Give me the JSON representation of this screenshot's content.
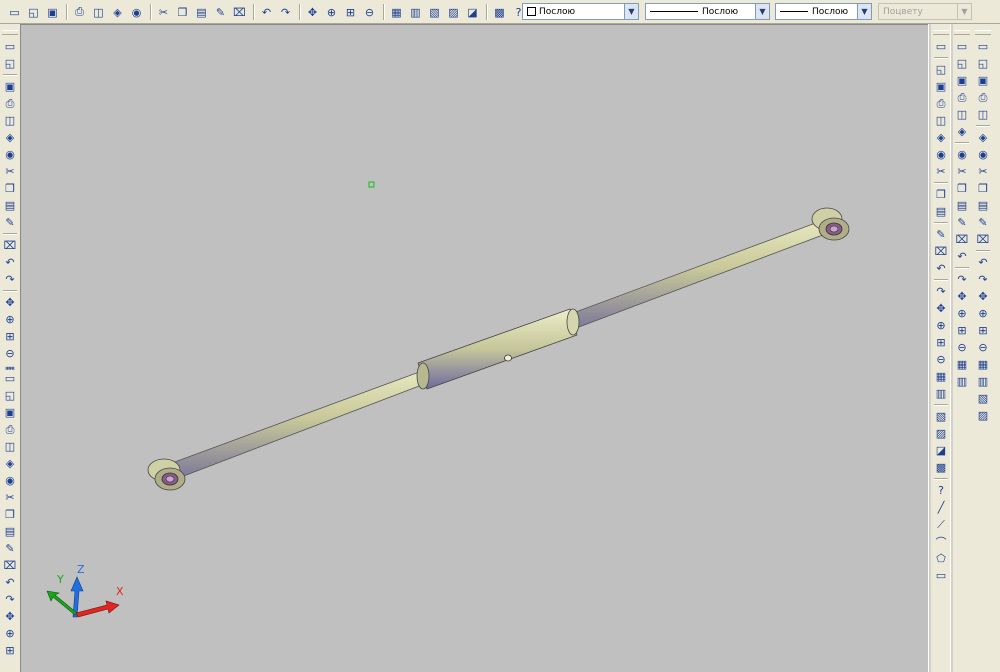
{
  "toolbar": {
    "standard_icons": [
      "new-icon",
      "open-icon",
      "save-icon",
      "print-icon",
      "print-preview-icon",
      "publish-icon",
      "3d-dwf-icon",
      "cut-icon",
      "copy-icon",
      "paste-icon",
      "match-properties-icon",
      "block-editor-icon",
      "undo-icon",
      "redo-icon",
      "pan-icon",
      "zoom-realtime-icon",
      "zoom-window-icon",
      "zoom-previous-icon",
      "properties-icon",
      "design-center-icon",
      "tool-palettes-icon",
      "sheet-set-icon",
      "markup-icon",
      "calculator-icon",
      "help-icon"
    ],
    "color_combo": {
      "value": "Послою",
      "swatch": "#ffffff"
    },
    "linetype_combo": {
      "value": "Послою"
    },
    "lineweight_combo": {
      "value": "Послою"
    },
    "plotstyle_combo": {
      "value": "Поцвету"
    }
  },
  "draw_toolbar": {
    "icons": [
      "line-icon",
      "construction-line-icon",
      "polyline-icon",
      "polygon-icon",
      "rectangle-icon",
      "arc-icon",
      "circle-icon",
      "revision-cloud-icon",
      "spline-icon",
      "ellipse-icon",
      "ellipse-arc-icon",
      "insert-block-icon",
      "make-block-icon",
      "point-icon",
      "hatch-icon",
      "gradient-icon",
      "region-icon",
      "table-icon",
      "multiline-text-icon"
    ]
  },
  "modify_toolbar": {
    "icons": [
      "erase-icon",
      "copy-object-icon",
      "mirror-icon",
      "offset-icon",
      "array-icon",
      "move-icon",
      "rotate-icon",
      "scale-icon",
      "stretch-icon",
      "trim-icon",
      "extend-icon",
      "break-at-point-icon",
      "break-icon",
      "join-icon",
      "chamfer-icon",
      "fillet-icon",
      "explode-icon"
    ]
  },
  "right_toolbar_a": {
    "icons": [
      "text-style-icon",
      "box-icon",
      "wedge-icon",
      "cone-icon",
      "sphere-icon",
      "cylinder-icon",
      "torus-icon",
      "union-icon",
      "subtract-icon",
      "intersect-icon",
      "extrude-face-icon",
      "move-face-icon",
      "offset-face-icon",
      "delete-face-icon",
      "rotate-face-icon",
      "taper-face-icon",
      "copy-face-icon",
      "color-face-icon",
      "imprint-icon",
      "clean-icon",
      "separate-icon",
      "shell-icon",
      "check-icon",
      "orbit-icon",
      "camera-icon",
      "walk-icon",
      "fly-icon",
      "render-icon",
      "materials-icon",
      "lights-icon"
    ]
  },
  "right_toolbar_b": {
    "icons": [
      "ucs-icon",
      "ucs-world-icon",
      "ucs-previous-icon",
      "ucs-face-icon",
      "ucs-object-icon",
      "ucs-view-icon",
      "ucs-origin-icon",
      "ucs-z-axis-icon",
      "ucs-3point-icon",
      "ucs-x-icon",
      "ucs-y-icon",
      "ucs-z-icon",
      "named-ucs-icon",
      "snap-endpoint-icon",
      "snap-midpoint-icon",
      "snap-intersection-icon",
      "snap-apparent-icon",
      "snap-extension-icon",
      "snap-center-icon",
      "snap-quadrant-icon",
      "snap-tangent-icon",
      "snap-perpendicular-icon",
      "snap-parallel-icon",
      "snap-insert-icon",
      "snap-node-icon",
      "snap-nearest-icon",
      "snap-none-icon",
      "osnap-settings-icon",
      "dim-linear-icon",
      "dim-aligned-icon",
      "dim-arc-icon",
      "dim-ordinate-icon",
      "dim-radius-icon",
      "dim-jogged-icon",
      "dim-diameter-icon",
      "dim-angular-icon",
      "quick-dim-icon",
      "dim-baseline-icon",
      "dim-continue-icon",
      "dim-space-icon",
      "dim-break-icon",
      "tolerance-icon"
    ]
  },
  "viewport": {
    "background": "#c0c0c0",
    "ucs_labels": {
      "x": "X",
      "y": "Y",
      "z": "Z"
    },
    "colors": {
      "x_axis": "#e0261e",
      "y_axis": "#1aa61a",
      "z_axis": "#1f6fe0",
      "rod": "#c8c89a",
      "bushing": "#8a5a8a"
    }
  }
}
